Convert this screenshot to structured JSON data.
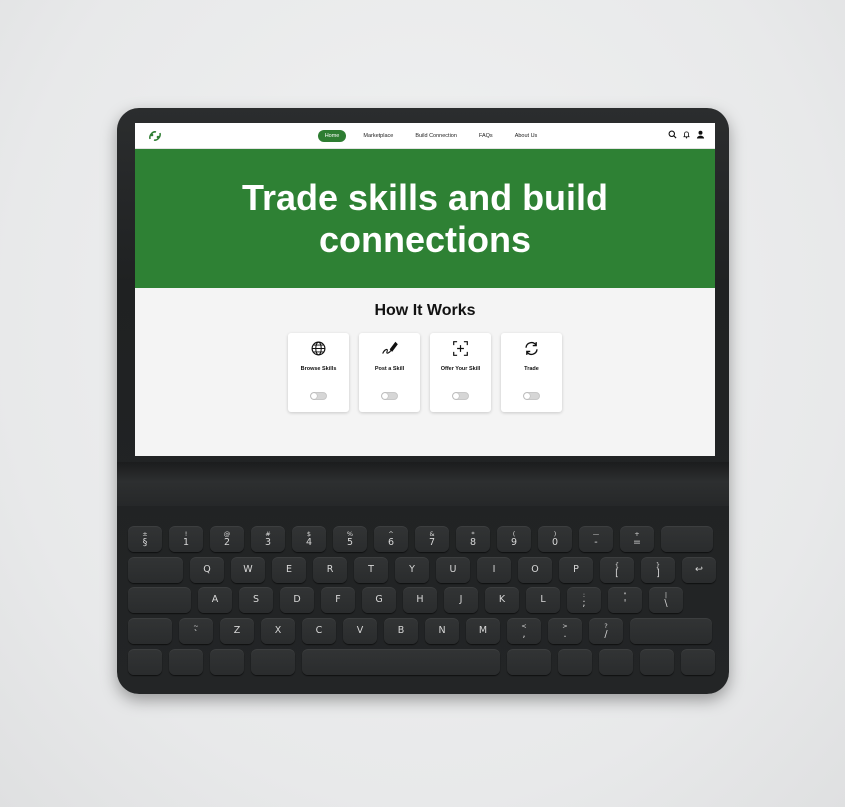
{
  "nav": {
    "links": [
      "Home",
      "Marketplace",
      "Build Connection",
      "FAQs",
      "About Us"
    ],
    "active_index": 0,
    "icons": [
      "search-icon",
      "bell-icon",
      "user-icon"
    ]
  },
  "hero": {
    "title": "Trade skills and build connections"
  },
  "how_it_works": {
    "title": "How It Works",
    "cards": [
      {
        "label": "Browse Skills",
        "icon": "globe-icon"
      },
      {
        "label": "Post a Skill",
        "icon": "pen-icon"
      },
      {
        "label": "Offer Your Skill",
        "icon": "add-frame-icon"
      },
      {
        "label": "Trade",
        "icon": "refresh-icon"
      }
    ]
  },
  "colors": {
    "brand_green": "#2e8134",
    "active_pill": "#2e7d32"
  },
  "keyboard": {
    "row1": [
      [
        "±",
        "§"
      ],
      [
        "!",
        "1"
      ],
      [
        "@",
        "2"
      ],
      [
        "#",
        "3"
      ],
      [
        "$",
        "4"
      ],
      [
        "%",
        "5"
      ],
      [
        "^",
        "6"
      ],
      [
        "&",
        "7"
      ],
      [
        "*",
        "8"
      ],
      [
        "(",
        "9"
      ],
      [
        ")",
        "0"
      ],
      [
        "—",
        "-"
      ],
      [
        "+",
        "="
      ]
    ],
    "row2": [
      [
        "",
        "Q"
      ],
      [
        "",
        "W"
      ],
      [
        "",
        "E"
      ],
      [
        "",
        "R"
      ],
      [
        "",
        "T"
      ],
      [
        "",
        "Y"
      ],
      [
        "",
        "U"
      ],
      [
        "",
        "I"
      ],
      [
        "",
        "O"
      ],
      [
        "",
        "P"
      ],
      [
        "{",
        "["
      ],
      [
        "}",
        "]"
      ],
      [
        "",
        "↩"
      ]
    ],
    "row3": [
      [
        "",
        "A"
      ],
      [
        "",
        "S"
      ],
      [
        "",
        "D"
      ],
      [
        "",
        "F"
      ],
      [
        "",
        "G"
      ],
      [
        "",
        "H"
      ],
      [
        "",
        "J"
      ],
      [
        "",
        "K"
      ],
      [
        "",
        "L"
      ],
      [
        ":",
        ";"
      ],
      [
        "\"",
        "'"
      ],
      [
        "|",
        "\\"
      ]
    ],
    "row4": [
      [
        "~",
        "`"
      ],
      [
        "",
        "Z"
      ],
      [
        "",
        "X"
      ],
      [
        "",
        "C"
      ],
      [
        "",
        "V"
      ],
      [
        "",
        "B"
      ],
      [
        "",
        "N"
      ],
      [
        "",
        "M"
      ],
      [
        "<",
        ","
      ],
      [
        ">",
        "."
      ],
      [
        "?",
        "/"
      ]
    ]
  }
}
